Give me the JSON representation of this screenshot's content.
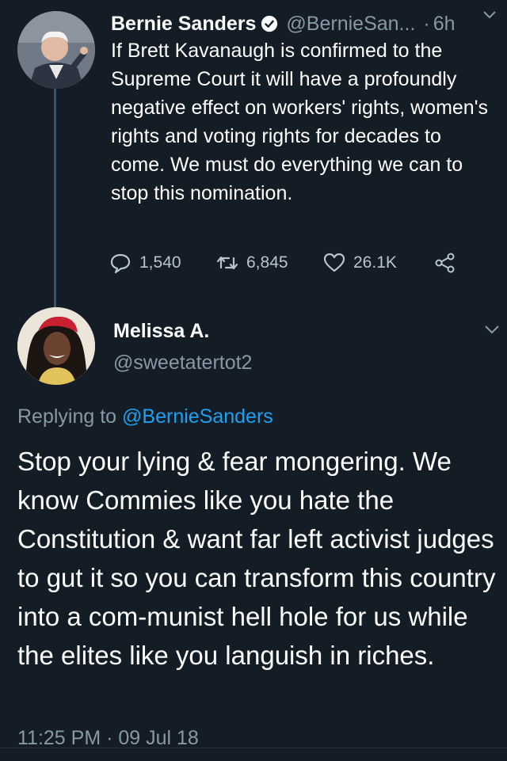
{
  "original_tweet": {
    "author_name": "Bernie Sanders",
    "handle": "@BernieSan...",
    "separator": "·",
    "time": "6h",
    "text": "If Brett Kavanaugh is confirmed to the Supreme Court it will have a profoundly negative effect on workers' rights, women's rights and voting rights for decades to come. We must do everything we can to stop this nomination.",
    "replies": "1,540",
    "retweets": "6,845",
    "likes": "26.1K"
  },
  "reply_tweet": {
    "author_name": "Melissa A.",
    "handle": "@sweetatertot2",
    "replying_prefix": "Replying to",
    "replying_to": "@BernieSanders",
    "text": "Stop your lying & fear mongering. We know Commies like you hate the Constitution & want far left activist judges to gut it so you can transform this country into a com-munist hell hole for us while the elites like you languish in riches.",
    "timestamp": "11:25 PM · 09 Jul 18"
  },
  "colors": {
    "background": "#141d26",
    "secondary_text": "#8899a6",
    "link": "#1da1f2"
  }
}
